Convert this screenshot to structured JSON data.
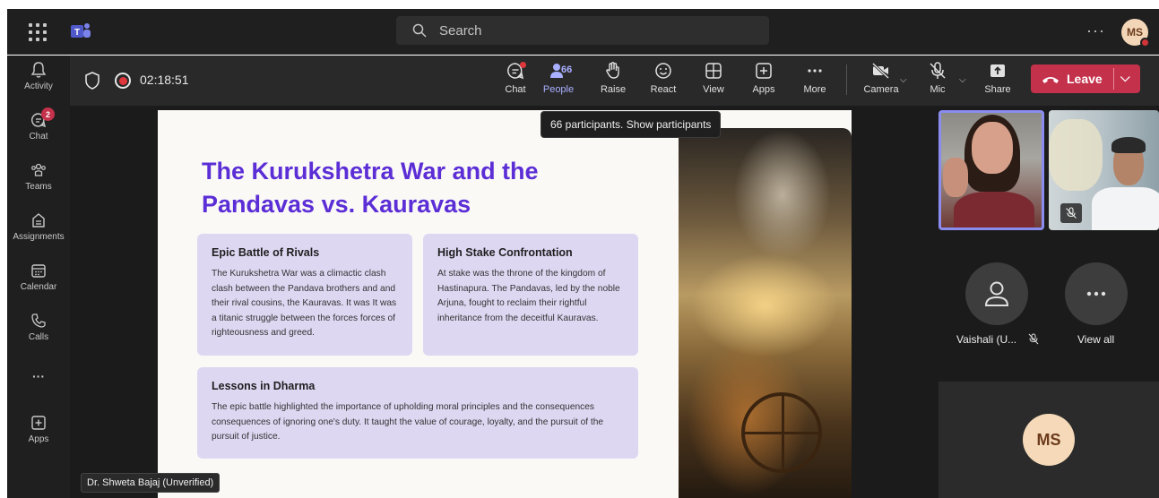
{
  "topbar": {
    "search_placeholder": "Search",
    "more": "···",
    "avatar_initials": "MS"
  },
  "rail": {
    "items": [
      {
        "label": "Activity",
        "icon": "bell-icon"
      },
      {
        "label": "Chat",
        "icon": "chat-icon",
        "badge": "2"
      },
      {
        "label": "Teams",
        "icon": "teams-icon"
      },
      {
        "label": "Assignments",
        "icon": "assignments-icon"
      },
      {
        "label": "Calendar",
        "icon": "calendar-icon"
      },
      {
        "label": "Calls",
        "icon": "phone-icon"
      },
      {
        "label": "···",
        "icon": "more-icon"
      },
      {
        "label": "Apps",
        "icon": "apps-icon"
      }
    ]
  },
  "meeting": {
    "timer": "02:18:51",
    "people_count": "66",
    "tools": {
      "chat": "Chat",
      "people": "People",
      "raise": "Raise",
      "react": "React",
      "view": "View",
      "apps": "Apps",
      "more": "More",
      "camera": "Camera",
      "mic": "Mic",
      "share": "Share"
    },
    "leave": "Leave",
    "tooltip": "66 participants. Show participants"
  },
  "slide": {
    "title": "The Kurukshetra War and the Pandavas vs. Kauravas",
    "cards": [
      {
        "heading": "Epic Battle of Rivals",
        "body": "The Kurukshetra War was a climactic clash clash between the Pandava brothers and and their rival cousins, the Kauravas. It was It was a titanic struggle between the forces forces of righteousness and greed."
      },
      {
        "heading": "High Stake Confrontation",
        "body": "At stake was the throne of the kingdom of Hastinapura. The Pandavas, led by the noble Arjuna, fought to reclaim their rightful inheritance from the deceitful Kauravas."
      },
      {
        "heading": "Lessons in Dharma",
        "body": "The epic battle highlighted the importance of upholding moral principles and the consequences consequences of ignoring one's duty. It taught the value of courage, loyalty, and the pursuit of the pursuit of justice."
      }
    ]
  },
  "presenter_name": "Dr. Shweta Bajaj (Unverified)",
  "participants": {
    "vaishali": "Vaishali (U...",
    "view_all": "View all",
    "ms_initials": "MS"
  },
  "colors": {
    "accent": "#5b2ed6",
    "leave_red": "#c4314b",
    "active_tool": "#a9b0ff",
    "card_bg": "#ddd7f2"
  }
}
